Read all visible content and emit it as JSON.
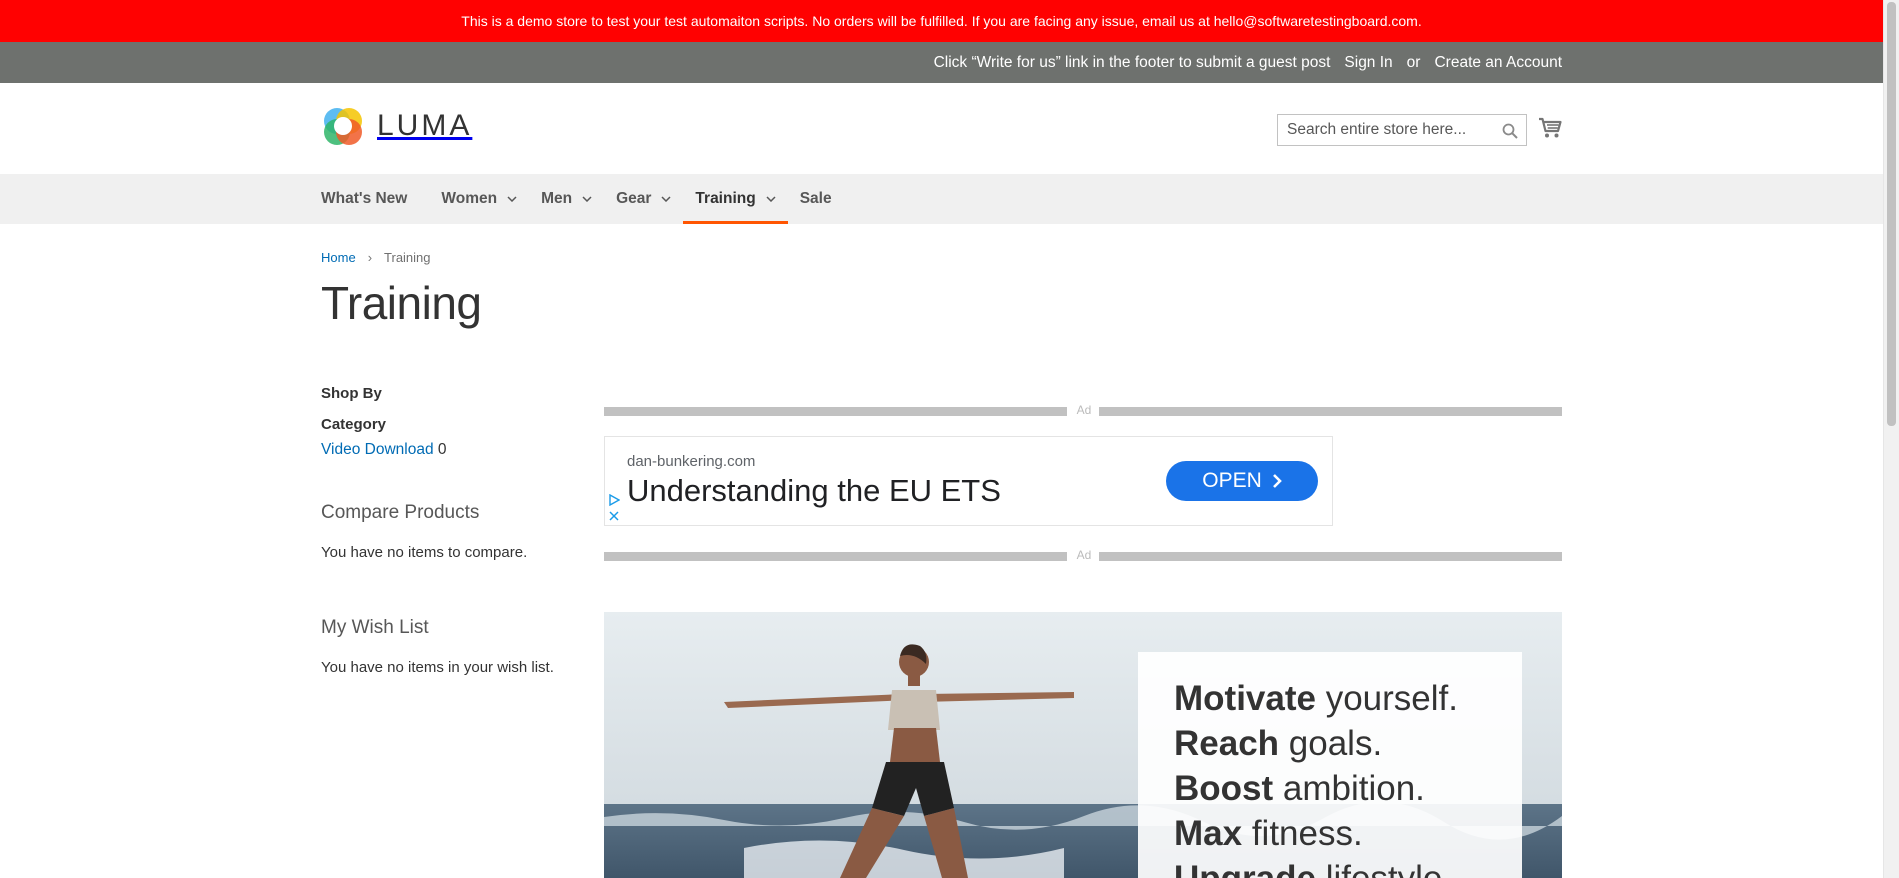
{
  "banner": {
    "text": "This is a demo store to test your test automaiton scripts. No orders will be fulfilled. If you are facing any issue, email us at hello@softwaretestingboard.com."
  },
  "header_panel": {
    "guest_post_text": "Click “Write for us” link in the footer to submit a guest post",
    "sign_in": "Sign In",
    "or": "or",
    "create_account": "Create an Account"
  },
  "logo": {
    "text": "LUMA"
  },
  "search": {
    "placeholder": "Search entire store here..."
  },
  "nav": {
    "items": [
      {
        "label": "What's New",
        "has_dropdown": false
      },
      {
        "label": "Women",
        "has_dropdown": true
      },
      {
        "label": "Men",
        "has_dropdown": true
      },
      {
        "label": "Gear",
        "has_dropdown": true
      },
      {
        "label": "Training",
        "has_dropdown": true,
        "active": true
      },
      {
        "label": "Sale",
        "has_dropdown": false
      }
    ]
  },
  "breadcrumb": {
    "home": "Home",
    "separator": "›",
    "current": "Training"
  },
  "page": {
    "title": "Training"
  },
  "sidebar": {
    "shop_by": "Shop By",
    "category_title": "Category",
    "category_items": [
      {
        "label": "Video Download",
        "count": "0"
      }
    ],
    "compare_title": "Compare Products",
    "compare_text": "You have no items to compare.",
    "wishlist_title": "My Wish List",
    "wishlist_text": "You have no items in your wish list."
  },
  "ad": {
    "label": "Ad",
    "domain": "dan-bunkering.com",
    "headline": "Understanding the EU ETS",
    "cta": "OPEN"
  },
  "hero": {
    "lines": [
      {
        "bold": "Motivate",
        "rest": " yourself."
      },
      {
        "bold": "Reach",
        "rest": " goals."
      },
      {
        "bold": "Boost",
        "rest": " ambition."
      },
      {
        "bold": "Max",
        "rest": " fitness."
      },
      {
        "bold": "Upgrade",
        "rest": " lifestyle."
      }
    ]
  },
  "colors": {
    "banner_bg": "#ff0101",
    "header_panel_bg": "#6e716e",
    "nav_bg": "#f0f0f0",
    "active_underline": "#ff5501",
    "link": "#006bb4",
    "ad_button": "#1a73e8"
  },
  "icons": [
    "luma-logo-icon",
    "search-icon",
    "cart-icon",
    "chevron-down-icon",
    "chevron-right-icon",
    "adchoices-icon",
    "close-icon"
  ]
}
